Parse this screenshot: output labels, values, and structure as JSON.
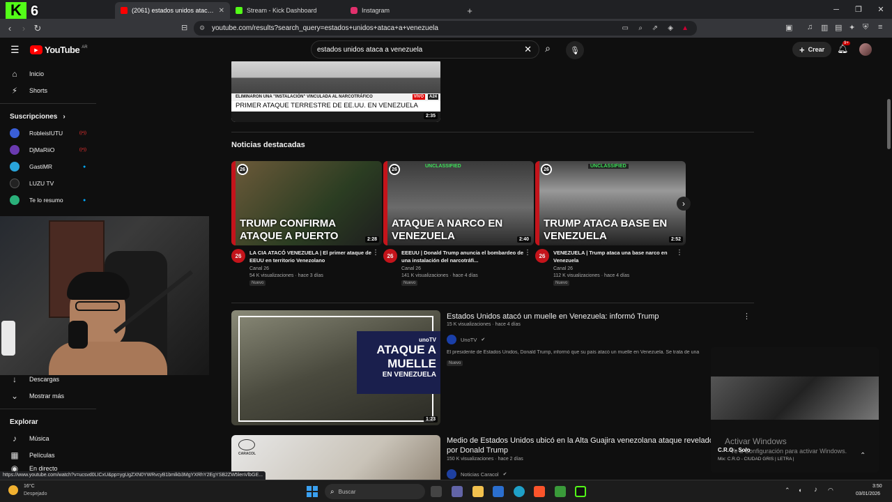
{
  "browser": {
    "tabs": [
      {
        "title": "(2061) estados unidos ataca a ve",
        "active": true,
        "color": "#ff0000"
      },
      {
        "title": "Stream - Kick Dashboard",
        "active": false,
        "color": "#53fc18"
      },
      {
        "title": "Instagram",
        "active": false,
        "color": "#e1306c"
      }
    ],
    "url": "youtube.com/results?search_query=estados+unidos+ataca+a+venezuela",
    "status_url": "https://www.youtube.com/watch?v=ucsvd0LICxU&pp=ygUgZXN0YWRvcyB1bmlkb3MgYXRhY2EgYSB2ZW5lenVlbGE..."
  },
  "overlay": {
    "k_logo": "K",
    "k_count": "6"
  },
  "youtube": {
    "logo_text": "YouTube",
    "region": "AR",
    "search_value": "estados unidos ataca a venezuela",
    "create_label": "Crear",
    "notif_count": "9+"
  },
  "sidebar": {
    "items": [
      {
        "label": "Inicio",
        "icon": "home-icon"
      },
      {
        "label": "Shorts",
        "icon": "shorts-icon"
      }
    ],
    "subs_header": "Suscripciones",
    "subs": [
      {
        "name": "RobleisIUTU",
        "color": "#3a5fd9",
        "live": true
      },
      {
        "name": "DjMaRiiO",
        "color": "#6a3ab0",
        "live": true
      },
      {
        "name": "GastiMR",
        "color": "#29a3d9",
        "live": false
      },
      {
        "name": "LUZU TV",
        "color": "#222222",
        "live": false
      },
      {
        "name": "Te lo resumo",
        "color": "#2ab07a",
        "live": false
      }
    ],
    "lower": [
      {
        "label": "Descargas",
        "icon": "download-icon"
      },
      {
        "label": "Mostrar más",
        "icon": "chevron-down-icon"
      }
    ],
    "explore_header": "Explorar",
    "explore": [
      {
        "label": "Música",
        "icon": "music-icon"
      },
      {
        "label": "Películas",
        "icon": "film-icon"
      },
      {
        "label": "En directo",
        "icon": "live-icon"
      }
    ]
  },
  "top_video": {
    "ticker1": "ELIMINARON UNA \"INSTALACIÓN\" VINCULADA AL NARCOTRÁFICO",
    "ticker2": "PRIMER ATAQUE TERRESTRE DE EE.UU. EN VENEZUELA",
    "live_tag": "VIVO",
    "channel_tag": "A24",
    "duration": "2:35"
  },
  "news": {
    "title": "Noticias destacadas",
    "cards": [
      {
        "caption": "TRUMP CONFIRMA ATAQUE A PUERTO",
        "duration": "2:28",
        "title": "LA CIA ATACÓ VENEZUELA | El primer ataque de EEUU en territorio Venezolano",
        "channel": "Canal 26",
        "views": "54 K visualizaciones",
        "age": "hace 3 días",
        "badge": "Nuevo",
        "unclassified": ""
      },
      {
        "caption": "ATAQUE A NARCO EN VENEZUELA",
        "duration": "2:40",
        "title": "EEEUU | Donald Trump anuncia el bombardeo de una instalación del narcotráfi...",
        "channel": "Canal 26",
        "views": "141 K visualizaciones",
        "age": "hace 4 días",
        "badge": "Nuevo",
        "unclassified": "UNCLASSIFIED"
      },
      {
        "caption": "TRUMP ATACA BASE EN VENEZUELA",
        "duration": "2:52",
        "title": "VENEZUELA | Trump ataca una base narco en Venezuela",
        "channel": "Canal 26",
        "views": "112 K visualizaciones",
        "age": "hace 4 días",
        "badge": "Nuevo",
        "unclassified": "UNCLASSIFIED"
      }
    ]
  },
  "results": [
    {
      "title": "Estados Unidos atacó un muelle en Venezuela: informó Trump",
      "views": "15 K visualizaciones",
      "age": "hace 4 días",
      "channel": "UnoTV",
      "desc": "El presidente de Estados Unidos, Donald Trump, informó que su país atacó un muelle en Venezuela. Se trata de una",
      "badge": "Nuevo",
      "thumb_line1": "ATAQUE A",
      "thumb_line2": "MUELLE",
      "thumb_line3": "EN VENEZUELA",
      "thumb_brand": "unoTV",
      "duration": "1:23"
    },
    {
      "title": "Medio de Estados Unidos ubicó en la Alta Guajira venezolana ataque revelado por Donald Trump",
      "views": "150 K visualizaciones",
      "age": "hace 2 días",
      "channel": "Noticias Caracol",
      "thumb_brand": "CARACOL"
    }
  ],
  "spotify": {
    "watermark1": "Activar Windows",
    "watermark2": "Ve a Configuración para activar Windows.",
    "track": "C.R.O - Solo",
    "mix": "Mix: C.R.O - CIUDAD GRIS | LETRA |"
  },
  "taskbar": {
    "weather_temp": "16°C",
    "weather_desc": "Despejado",
    "search_placeholder": "Buscar",
    "time": "3:50",
    "date": "03/01/2026"
  }
}
